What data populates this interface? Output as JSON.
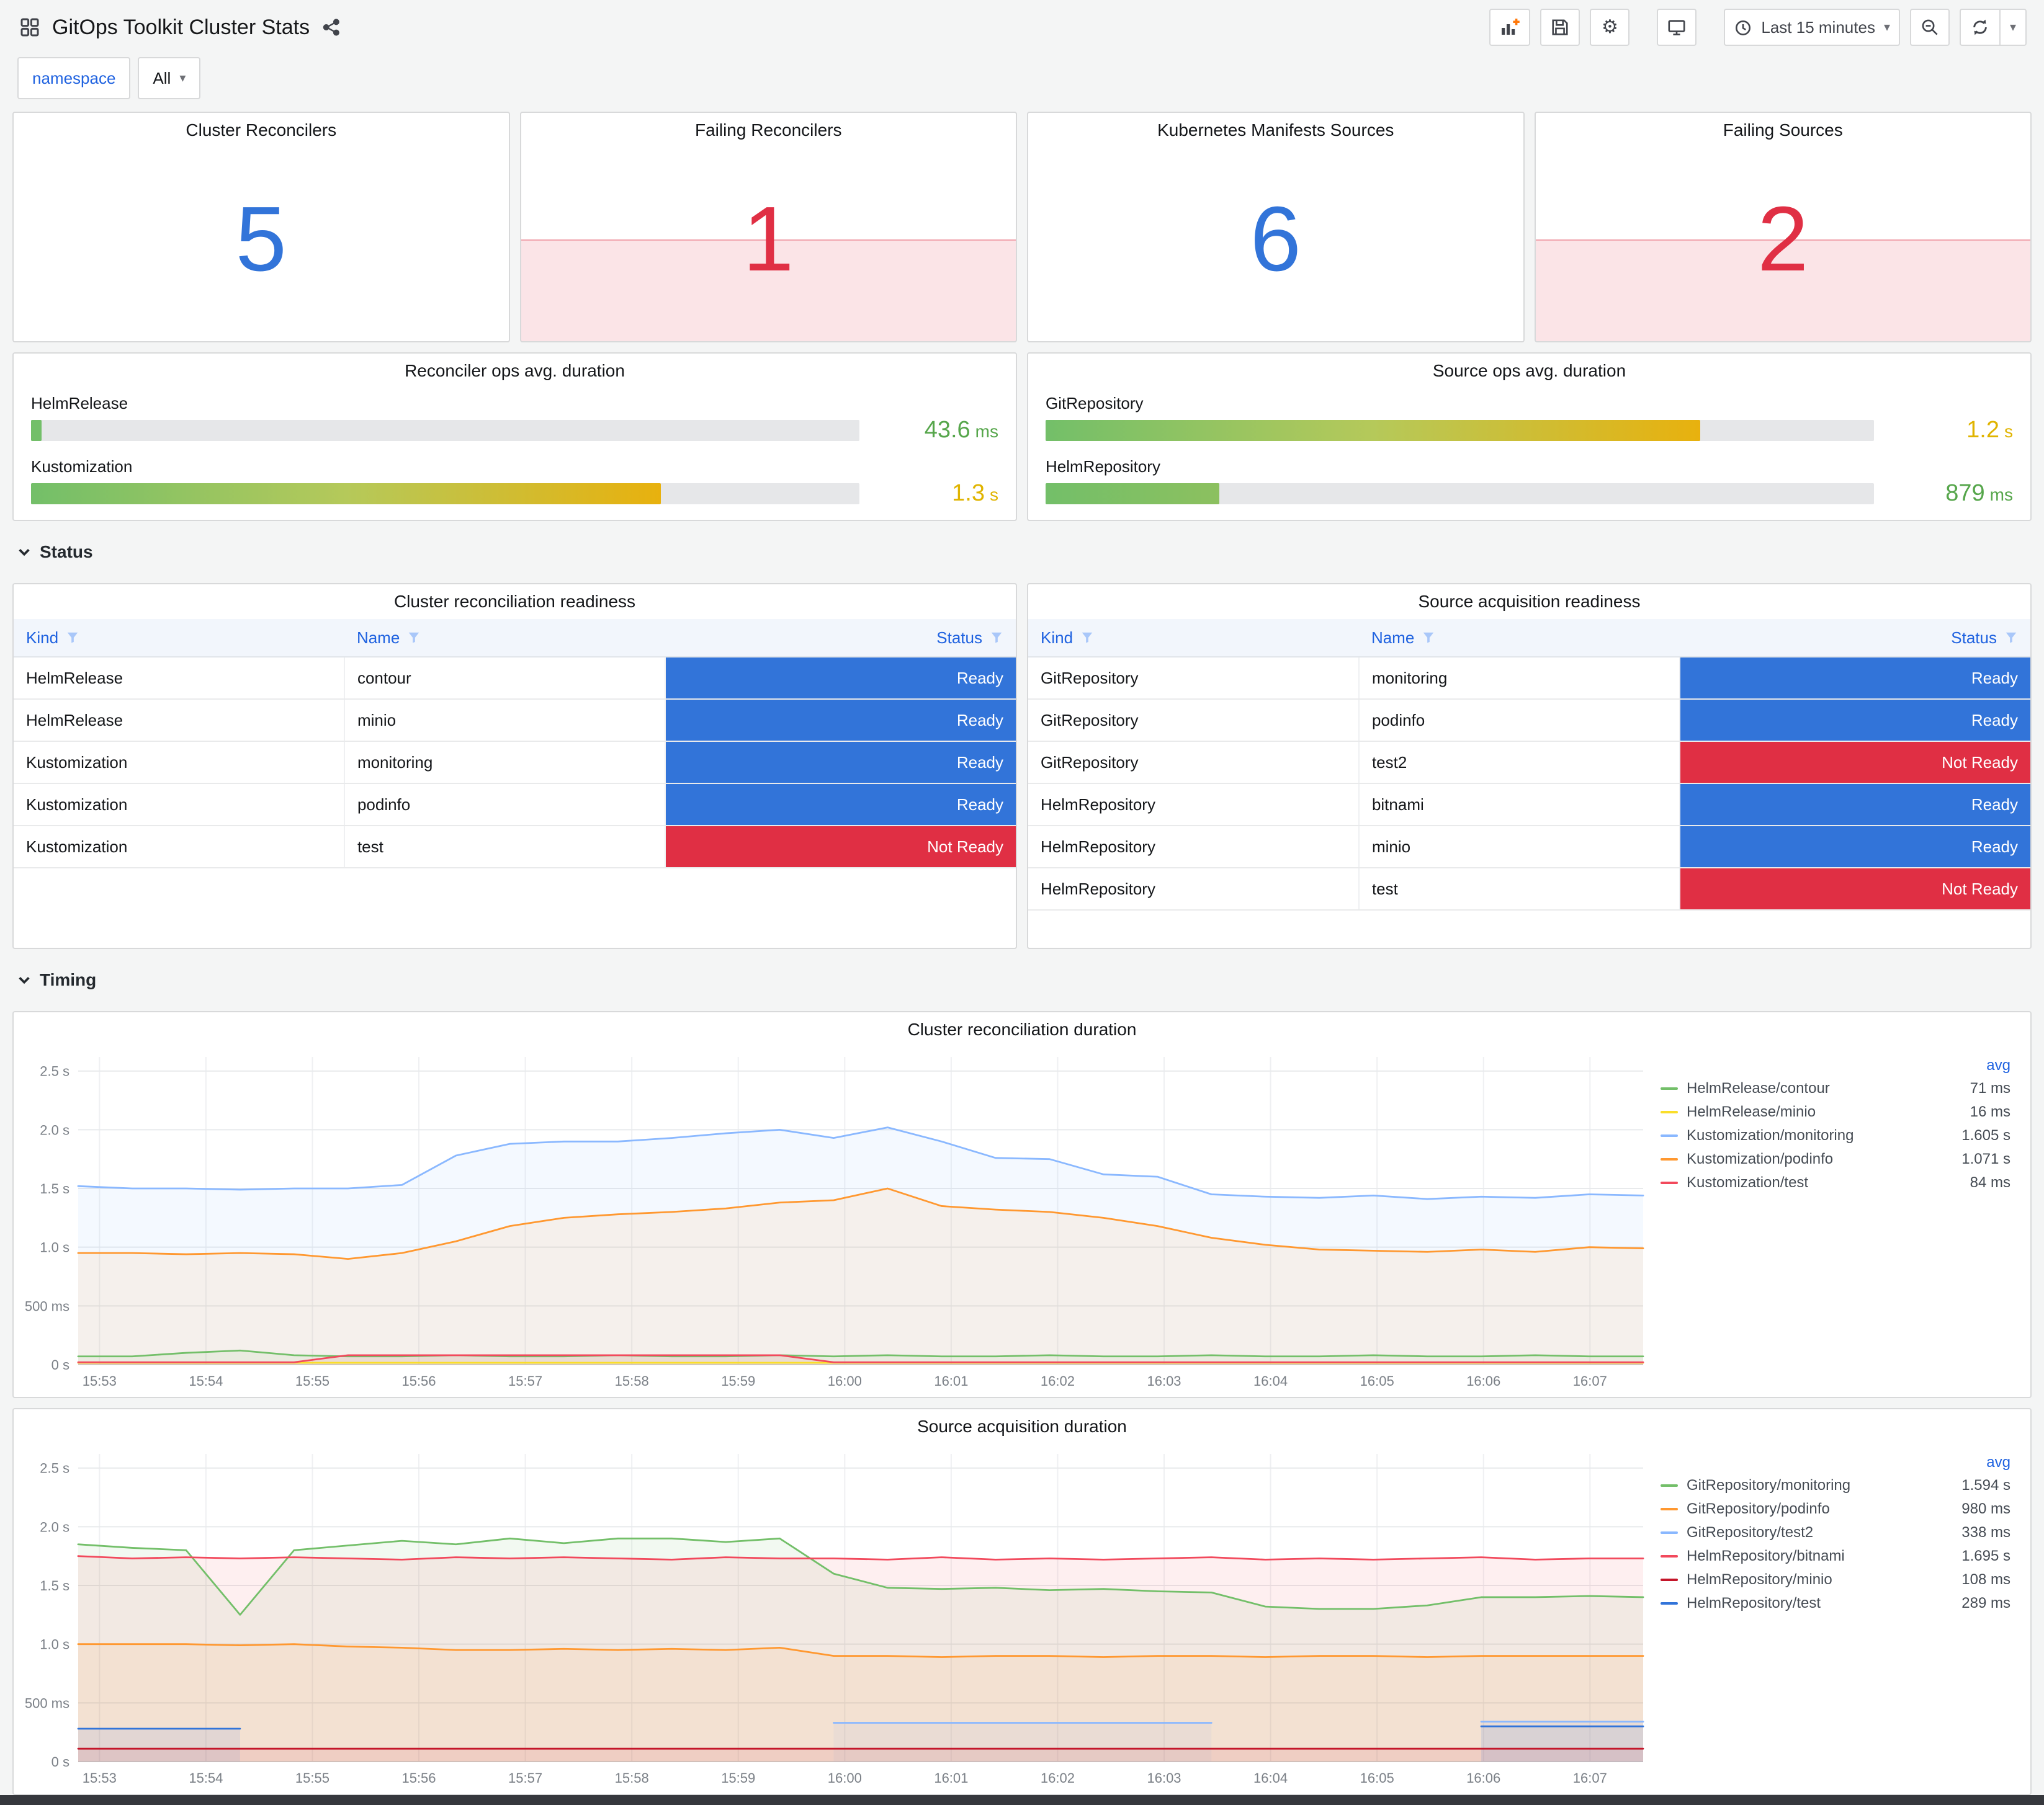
{
  "header": {
    "title": "GitOps Toolkit Cluster Stats",
    "time_range": "Last 15 minutes"
  },
  "icons": {
    "caret": "▾",
    "gear": "⚙"
  },
  "variables": {
    "namespace_label": "namespace",
    "namespace_value": "All"
  },
  "sections": {
    "status": "Status",
    "timing": "Timing"
  },
  "colors": {
    "stat_ok": "#3274D9",
    "stat_alert": "#E02F44",
    "ready": "#3274D9",
    "not_ready": "#E02F44"
  },
  "stats": [
    {
      "title": "Cluster Reconcilers",
      "value": "5",
      "state": "ok"
    },
    {
      "title": "Failing Reconcilers",
      "value": "1",
      "state": "alert"
    },
    {
      "title": "Kubernetes Manifests Sources",
      "value": "6",
      "state": "ok"
    },
    {
      "title": "Failing Sources",
      "value": "2",
      "state": "alert"
    }
  ],
  "gauges": [
    {
      "title": "Reconciler ops avg. duration",
      "rows": [
        {
          "label": "HelmRelease",
          "value": "43.6",
          "unit": "ms",
          "pct": 1.3,
          "value_color": "#56A64B",
          "bar_stops": [
            "#73BF69"
          ]
        },
        {
          "label": "Kustomization",
          "value": "1.3",
          "unit": "s",
          "pct": 76,
          "value_color": "#E0B400",
          "bar_stops": [
            "#73BF69",
            "#B5C95A",
            "#E8B10E"
          ]
        }
      ]
    },
    {
      "title": "Source ops avg. duration",
      "rows": [
        {
          "label": "GitRepository",
          "value": "1.2",
          "unit": "s",
          "pct": 79,
          "value_color": "#E0B400",
          "bar_stops": [
            "#73BF69",
            "#B5C95A",
            "#E8B10E"
          ]
        },
        {
          "label": "HelmRepository",
          "value": "879",
          "unit": "ms",
          "pct": 21,
          "value_color": "#56A64B",
          "bar_stops": [
            "#73BF69",
            "#8CC05F"
          ]
        }
      ]
    }
  ],
  "tables": [
    {
      "title": "Cluster reconciliation readiness",
      "columns": [
        "Kind",
        "Name",
        "Status"
      ],
      "rows": [
        [
          "HelmRelease",
          "contour",
          "Ready"
        ],
        [
          "HelmRelease",
          "minio",
          "Ready"
        ],
        [
          "Kustomization",
          "monitoring",
          "Ready"
        ],
        [
          "Kustomization",
          "podinfo",
          "Ready"
        ],
        [
          "Kustomization",
          "test",
          "Not Ready"
        ]
      ]
    },
    {
      "title": "Source acquisition readiness",
      "columns": [
        "Kind",
        "Name",
        "Status"
      ],
      "rows": [
        [
          "GitRepository",
          "monitoring",
          "Ready"
        ],
        [
          "GitRepository",
          "podinfo",
          "Ready"
        ],
        [
          "GitRepository",
          "test2",
          "Not Ready"
        ],
        [
          "HelmRepository",
          "bitnami",
          "Ready"
        ],
        [
          "HelmRepository",
          "minio",
          "Ready"
        ],
        [
          "HelmRepository",
          "test",
          "Not Ready"
        ]
      ]
    }
  ],
  "chart_data": [
    {
      "type": "line",
      "title": "Cluster reconciliation duration",
      "legend_header": "avg",
      "legend_position": "right",
      "grid": true,
      "ylim": [
        0,
        2.5
      ],
      "y_max": 2.62,
      "y_ticks": [
        {
          "v": 0,
          "label": "0 s"
        },
        {
          "v": 0.5,
          "label": "500 ms"
        },
        {
          "v": 1,
          "label": "1.0 s"
        },
        {
          "v": 1.5,
          "label": "1.5 s"
        },
        {
          "v": 2,
          "label": "2.0 s"
        },
        {
          "v": 2.5,
          "label": "2.5 s"
        }
      ],
      "x_ticks": [
        "15:53",
        "15:54",
        "15:55",
        "15:56",
        "15:57",
        "15:58",
        "15:59",
        "16:00",
        "16:01",
        "16:02",
        "16:03",
        "16:04",
        "16:05",
        "16:06",
        "16:07"
      ],
      "x_tick_start": 0.0136,
      "x_tick_step": 0.06803,
      "series": [
        {
          "name": "HelmRelease/contour",
          "color": "#73BF69",
          "avg": "71 ms",
          "values": [
            0.07,
            0.07,
            0.1,
            0.12,
            0.08,
            0.07,
            0.07,
            0.08,
            0.07,
            0.07,
            0.08,
            0.07,
            0.07,
            0.08,
            0.07,
            0.08,
            0.07,
            0.07,
            0.08,
            0.07,
            0.07,
            0.08,
            0.07,
            0.07,
            0.08,
            0.07,
            0.07,
            0.08,
            0.07,
            0.07
          ]
        },
        {
          "name": "HelmRelease/minio",
          "color": "#FADE2A",
          "avg": "16 ms",
          "values": [
            0.016,
            0.016,
            0.016,
            0.016,
            0.016,
            0.016,
            0.016,
            0.016,
            0.016,
            0.016,
            0.016,
            0.016,
            0.016,
            0.016,
            0.016,
            0.016,
            0.016,
            0.016,
            0.016,
            0.016,
            0.016,
            0.016,
            0.016,
            0.016,
            0.016,
            0.016,
            0.016,
            0.016,
            0.016,
            0.016
          ]
        },
        {
          "name": "Kustomization/monitoring",
          "color": "#8AB8FF",
          "avg": "1.605 s",
          "values": [
            1.52,
            1.5,
            1.5,
            1.49,
            1.5,
            1.5,
            1.53,
            1.78,
            1.88,
            1.9,
            1.9,
            1.93,
            1.97,
            2.0,
            1.93,
            2.02,
            1.9,
            1.76,
            1.75,
            1.62,
            1.6,
            1.45,
            1.43,
            1.42,
            1.44,
            1.41,
            1.43,
            1.42,
            1.45,
            1.44
          ]
        },
        {
          "name": "Kustomization/podinfo",
          "color": "#FF9830",
          "avg": "1.071 s",
          "values": [
            0.95,
            0.95,
            0.94,
            0.95,
            0.94,
            0.9,
            0.95,
            1.05,
            1.18,
            1.25,
            1.28,
            1.3,
            1.33,
            1.38,
            1.4,
            1.5,
            1.35,
            1.32,
            1.3,
            1.25,
            1.18,
            1.08,
            1.02,
            0.98,
            0.97,
            0.96,
            0.98,
            0.96,
            1.0,
            0.99
          ]
        },
        {
          "name": "Kustomization/test",
          "color": "#F2495C",
          "avg": "84 ms",
          "values": [
            0.02,
            0.02,
            0.02,
            0.02,
            0.02,
            0.08,
            0.08,
            0.08,
            0.08,
            0.08,
            0.08,
            0.08,
            0.08,
            0.08,
            0.02,
            0.02,
            0.02,
            0.02,
            0.02,
            0.02,
            0.02,
            0.02,
            0.02,
            0.02,
            0.02,
            0.02,
            0.02,
            0.02,
            0.02,
            0.02
          ]
        }
      ]
    },
    {
      "type": "line",
      "title": "Source acquisition duration",
      "legend_header": "avg",
      "legend_position": "right",
      "grid": true,
      "ylim": [
        0,
        2.5
      ],
      "y_max": 2.62,
      "y_ticks": [
        {
          "v": 0,
          "label": "0 s"
        },
        {
          "v": 0.5,
          "label": "500 ms"
        },
        {
          "v": 1,
          "label": "1.0 s"
        },
        {
          "v": 1.5,
          "label": "1.5 s"
        },
        {
          "v": 2,
          "label": "2.0 s"
        },
        {
          "v": 2.5,
          "label": "2.5 s"
        }
      ],
      "x_ticks": [
        "15:53",
        "15:54",
        "15:55",
        "15:56",
        "15:57",
        "15:58",
        "15:59",
        "16:00",
        "16:01",
        "16:02",
        "16:03",
        "16:04",
        "16:05",
        "16:06",
        "16:07"
      ],
      "x_tick_start": 0.0136,
      "x_tick_step": 0.06803,
      "series": [
        {
          "name": "GitRepository/monitoring",
          "color": "#73BF69",
          "avg": "1.594 s",
          "values": [
            1.85,
            1.82,
            1.8,
            1.25,
            1.8,
            1.84,
            1.88,
            1.85,
            1.9,
            1.86,
            1.9,
            1.9,
            1.87,
            1.9,
            1.6,
            1.48,
            1.47,
            1.48,
            1.46,
            1.47,
            1.45,
            1.44,
            1.32,
            1.3,
            1.3,
            1.33,
            1.4,
            1.4,
            1.41,
            1.4
          ]
        },
        {
          "name": "GitRepository/podinfo",
          "color": "#FF9830",
          "avg": "980 ms",
          "values": [
            1.0,
            1.0,
            1.0,
            0.99,
            1.0,
            0.98,
            0.97,
            0.95,
            0.95,
            0.96,
            0.95,
            0.96,
            0.95,
            0.97,
            0.9,
            0.9,
            0.89,
            0.9,
            0.9,
            0.89,
            0.9,
            0.9,
            0.89,
            0.9,
            0.9,
            0.89,
            0.9,
            0.9,
            0.9,
            0.9
          ]
        },
        {
          "name": "GitRepository/test2",
          "color": "#8AB8FF",
          "avg": "338 ms",
          "values": [
            null,
            null,
            null,
            null,
            null,
            null,
            null,
            null,
            null,
            null,
            null,
            null,
            null,
            null,
            0.33,
            0.33,
            0.33,
            0.33,
            0.33,
            0.33,
            0.33,
            0.33,
            null,
            null,
            null,
            null,
            0.34,
            0.34,
            0.34,
            0.34
          ]
        },
        {
          "name": "HelmRepository/bitnami",
          "color": "#F2495C",
          "avg": "1.695 s",
          "values": [
            1.75,
            1.73,
            1.74,
            1.73,
            1.74,
            1.73,
            1.72,
            1.74,
            1.73,
            1.74,
            1.73,
            1.72,
            1.74,
            1.73,
            1.73,
            1.72,
            1.74,
            1.72,
            1.73,
            1.72,
            1.73,
            1.74,
            1.72,
            1.73,
            1.72,
            1.73,
            1.74,
            1.72,
            1.73,
            1.73
          ]
        },
        {
          "name": "HelmRepository/minio",
          "color": "#C4162A",
          "avg": "108 ms",
          "values": [
            0.11,
            0.11,
            0.11,
            0.11,
            0.11,
            0.11,
            0.11,
            0.11,
            0.11,
            0.11,
            0.11,
            0.11,
            0.11,
            0.11,
            0.11,
            0.11,
            0.11,
            0.11,
            0.11,
            0.11,
            0.11,
            0.11,
            0.11,
            0.11,
            0.11,
            0.11,
            0.11,
            0.11,
            0.11,
            0.11
          ]
        },
        {
          "name": "HelmRepository/test",
          "color": "#3274D9",
          "avg": "289 ms",
          "values": [
            0.28,
            0.28,
            0.28,
            0.28,
            null,
            null,
            null,
            null,
            null,
            null,
            null,
            null,
            null,
            null,
            null,
            null,
            null,
            null,
            null,
            null,
            null,
            null,
            null,
            null,
            null,
            null,
            0.3,
            0.3,
            0.3,
            0.3
          ]
        }
      ]
    }
  ]
}
